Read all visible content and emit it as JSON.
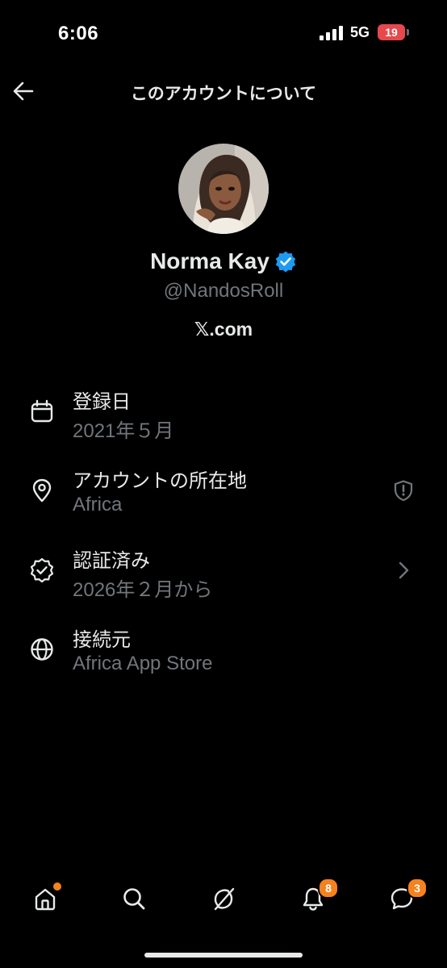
{
  "status_bar": {
    "time": "6:06",
    "network": "5G",
    "battery": "19"
  },
  "header": {
    "title": "このアカウントについて",
    "back_icon": "arrow-left-icon"
  },
  "profile": {
    "name": "Norma Kay",
    "handle": "@NandosRoll",
    "site": "𝕏.com",
    "verified_color": "#1d9bf0"
  },
  "info": [
    {
      "icon": "calendar-icon",
      "title": "登録日",
      "value": "2021年５月"
    },
    {
      "icon": "location-pin-icon",
      "title": "アカウントの所在地",
      "value": "Africa",
      "trailing_icon": "shield-icon"
    },
    {
      "icon": "verified-check-icon",
      "title": "認証済み",
      "value": "2026年２月から",
      "trailing_icon": "chevron-right-icon"
    },
    {
      "icon": "globe-icon",
      "title": "接続元",
      "value": "Africa App Store"
    }
  ],
  "tab_bar": {
    "home": {
      "icon": "home-icon"
    },
    "search": {
      "icon": "search-icon"
    },
    "grok": {
      "icon": "grok-icon"
    },
    "notifications": {
      "icon": "bell-icon",
      "badge": "8"
    },
    "messages": {
      "icon": "chat-bubble-icon",
      "badge": "3"
    },
    "badge_color": "#f4821f"
  }
}
